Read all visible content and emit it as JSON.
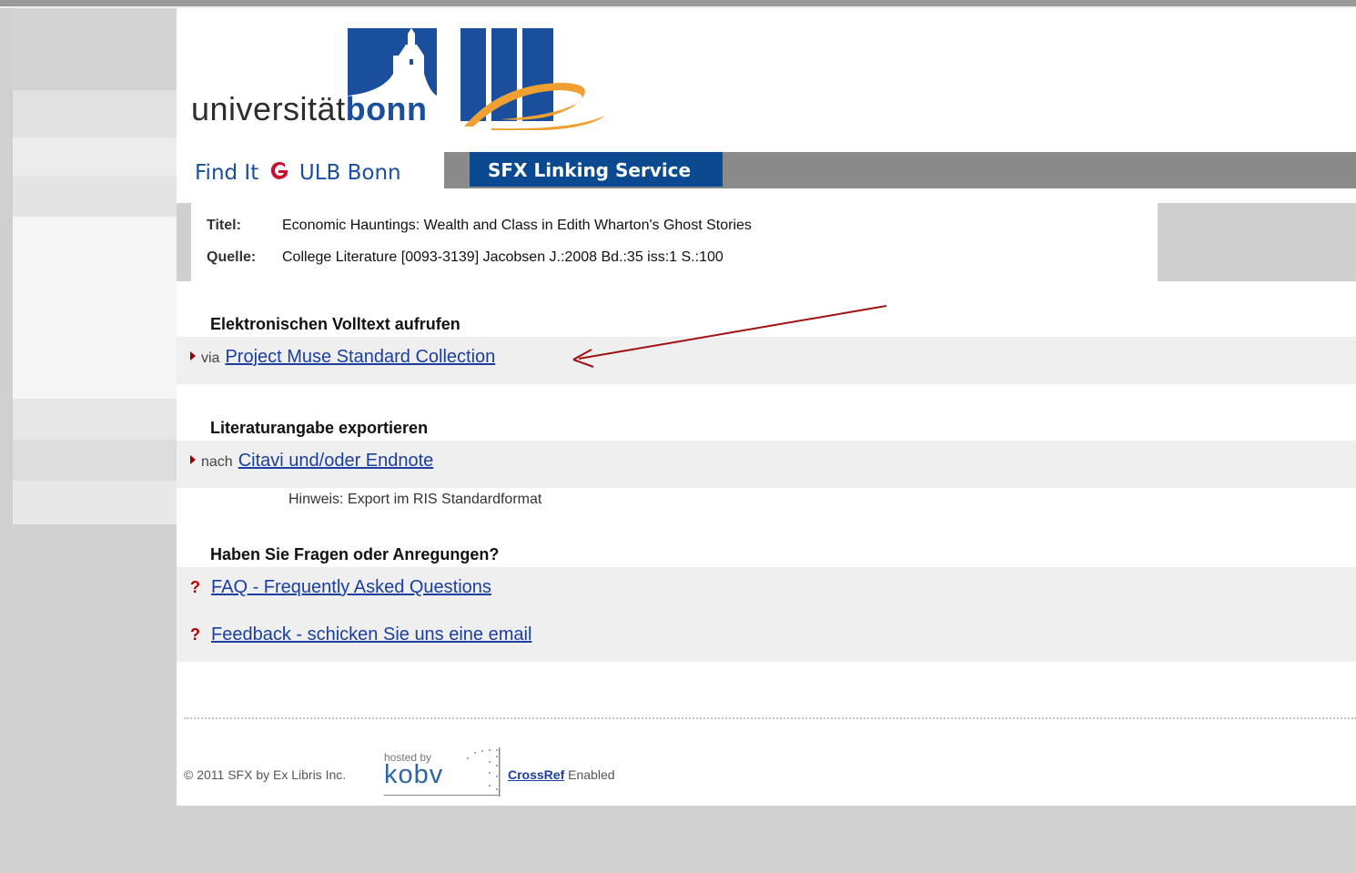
{
  "brand": {
    "logo_text_light": "universität",
    "logo_text_bold": "bonn",
    "findit_label": "Find It",
    "ulb_label": "ULB Bonn",
    "sfx_label": "SFX Linking Service",
    "blue": "#0b4a91",
    "orange": "#f0a030"
  },
  "record": {
    "title_key": "Titel:",
    "title_value": "Economic Hauntings: Wealth and Class in Edith Wharton's Ghost Stories",
    "source_key": "Quelle:",
    "source_value": "College Literature [0093-3139] Jacobsen J.:2008 Bd.:35 iss:1 S.:100"
  },
  "fulltext": {
    "heading": "Elektronischen Volltext aufrufen",
    "prefix": "via",
    "link": "Project Muse Standard Collection"
  },
  "export": {
    "heading": "Literaturangabe exportieren",
    "prefix": "nach",
    "link": "Citavi und/oder Endnote",
    "hint": "Hinweis: Export im RIS Standardformat"
  },
  "help": {
    "heading": "Haben Sie Fragen oder Anregungen?",
    "faq_marker": "?",
    "faq_link": "FAQ - Frequently Asked Questions",
    "feedback_marker": "?",
    "feedback_link": "Feedback - schicken Sie uns eine email"
  },
  "footer": {
    "copyright": "© 2011 SFX by Ex Libris Inc.",
    "hosted_by": "hosted by",
    "kobv": "kobv",
    "crossref_link": "CrossRef",
    "crossref_suffix": "Enabled"
  },
  "annotation_color": "#a01010"
}
